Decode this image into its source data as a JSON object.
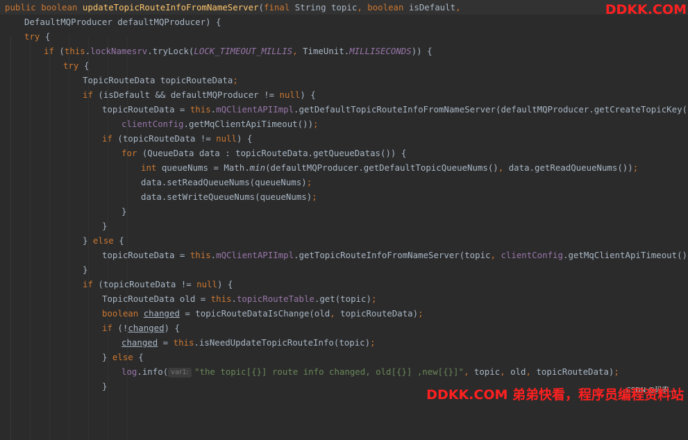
{
  "watermark": {
    "top": "DDKK.COM",
    "bottom": "DDKK.COM 弟弟快看，程序员编程资料站",
    "csdn": "CSDN @码农..."
  },
  "colors": {
    "background": "#2b2b2b",
    "keyword": "#cc7832",
    "method_declaration": "#ffc66d",
    "field": "#9876aa",
    "string": "#6a8759",
    "plain": "#a9b7c6",
    "watermark": "#ff2020"
  },
  "code_lines": [
    {
      "indent": 0,
      "tokens": [
        {
          "t": "kw",
          "v": "public boolean "
        },
        {
          "t": "fn",
          "v": "updateTopicRouteInfoFromNameServer"
        },
        {
          "t": "",
          "v": "("
        },
        {
          "t": "kw",
          "v": "final "
        },
        {
          "t": "",
          "v": "String topic"
        },
        {
          "t": "kw",
          "v": ", boolean "
        },
        {
          "t": "",
          "v": "isDefault"
        },
        {
          "t": "kw",
          "v": ","
        }
      ]
    },
    {
      "indent": 1,
      "tokens": [
        {
          "t": "",
          "v": "DefaultMQProducer defaultMQProducer) {"
        }
      ]
    },
    {
      "indent": 1,
      "tokens": [
        {
          "t": "kw",
          "v": "try "
        },
        {
          "t": "",
          "v": "{"
        }
      ]
    },
    {
      "indent": 2,
      "tokens": [
        {
          "t": "kw",
          "v": "if "
        },
        {
          "t": "",
          "v": "("
        },
        {
          "t": "kw",
          "v": "this"
        },
        {
          "t": "",
          "v": "."
        },
        {
          "t": "fld",
          "v": "lockNamesrv"
        },
        {
          "t": "",
          "v": ".tryLock("
        },
        {
          "t": "it",
          "v": "LOCK_TIMEOUT_MILLIS"
        },
        {
          "t": "kw",
          "v": ", "
        },
        {
          "t": "",
          "v": "TimeUnit."
        },
        {
          "t": "it",
          "v": "MILLISECONDS"
        },
        {
          "t": "",
          "v": ")) {"
        }
      ]
    },
    {
      "indent": 3,
      "tokens": [
        {
          "t": "kw",
          "v": "try "
        },
        {
          "t": "",
          "v": "{"
        }
      ]
    },
    {
      "indent": 4,
      "tokens": [
        {
          "t": "",
          "v": "TopicRouteData topicRouteData"
        },
        {
          "t": "kw",
          "v": ";"
        }
      ]
    },
    {
      "indent": 4,
      "tokens": [
        {
          "t": "kw",
          "v": "if "
        },
        {
          "t": "",
          "v": "(isDefault && defaultMQProducer != "
        },
        {
          "t": "kw",
          "v": "null"
        },
        {
          "t": "",
          "v": ") {"
        }
      ]
    },
    {
      "indent": 5,
      "tokens": [
        {
          "t": "",
          "v": "topicRouteData = "
        },
        {
          "t": "kw",
          "v": "this"
        },
        {
          "t": "",
          "v": "."
        },
        {
          "t": "fld",
          "v": "mQClientAPIImpl"
        },
        {
          "t": "",
          "v": ".getDefaultTopicRouteInfoFromNameServer(defaultMQProducer.getCreateTopicKey()"
        },
        {
          "t": "kw",
          "v": ","
        }
      ]
    },
    {
      "indent": 6,
      "tokens": [
        {
          "t": "fld",
          "v": "clientConfig"
        },
        {
          "t": "",
          "v": ".getMqClientApiTimeout())"
        },
        {
          "t": "kw",
          "v": ";"
        }
      ]
    },
    {
      "indent": 5,
      "tokens": [
        {
          "t": "kw",
          "v": "if "
        },
        {
          "t": "",
          "v": "(topicRouteData != "
        },
        {
          "t": "kw",
          "v": "null"
        },
        {
          "t": "",
          "v": ") {"
        }
      ]
    },
    {
      "indent": 6,
      "tokens": [
        {
          "t": "kw",
          "v": "for "
        },
        {
          "t": "",
          "v": "(QueueData data : topicRouteData.getQueueDatas()) {"
        }
      ]
    },
    {
      "indent": 7,
      "tokens": [
        {
          "t": "kw",
          "v": "int "
        },
        {
          "t": "",
          "v": "queueNums = Math."
        },
        {
          "t": "sm",
          "v": "min"
        },
        {
          "t": "",
          "v": "(defaultMQProducer.getDefaultTopicQueueNums()"
        },
        {
          "t": "kw",
          "v": ", "
        },
        {
          "t": "",
          "v": "data.getReadQueueNums())"
        },
        {
          "t": "kw",
          "v": ";"
        }
      ]
    },
    {
      "indent": 7,
      "tokens": [
        {
          "t": "",
          "v": "data.setReadQueueNums(queueNums)"
        },
        {
          "t": "kw",
          "v": ";"
        }
      ]
    },
    {
      "indent": 7,
      "tokens": [
        {
          "t": "",
          "v": "data.setWriteQueueNums(queueNums)"
        },
        {
          "t": "kw",
          "v": ";"
        }
      ]
    },
    {
      "indent": 6,
      "tokens": [
        {
          "t": "",
          "v": "}"
        }
      ]
    },
    {
      "indent": 5,
      "tokens": [
        {
          "t": "",
          "v": "}"
        }
      ]
    },
    {
      "indent": 4,
      "tokens": [
        {
          "t": "",
          "v": "} "
        },
        {
          "t": "kw",
          "v": "else "
        },
        {
          "t": "",
          "v": "{"
        }
      ]
    },
    {
      "indent": 5,
      "tokens": [
        {
          "t": "",
          "v": "topicRouteData = "
        },
        {
          "t": "kw",
          "v": "this"
        },
        {
          "t": "",
          "v": "."
        },
        {
          "t": "fld",
          "v": "mQClientAPIImpl"
        },
        {
          "t": "",
          "v": ".getTopicRouteInfoFromNameServer(topic"
        },
        {
          "t": "kw",
          "v": ", "
        },
        {
          "t": "fld",
          "v": "clientConfig"
        },
        {
          "t": "",
          "v": ".getMqClientApiTimeout())"
        },
        {
          "t": "kw",
          "v": ";"
        }
      ]
    },
    {
      "indent": 4,
      "tokens": [
        {
          "t": "",
          "v": "}"
        }
      ]
    },
    {
      "indent": 4,
      "tokens": [
        {
          "t": "kw",
          "v": "if "
        },
        {
          "t": "",
          "v": "(topicRouteData != "
        },
        {
          "t": "kw",
          "v": "null"
        },
        {
          "t": "",
          "v": ") {"
        }
      ]
    },
    {
      "indent": 5,
      "tokens": [
        {
          "t": "",
          "v": "TopicRouteData old = "
        },
        {
          "t": "kw",
          "v": "this"
        },
        {
          "t": "",
          "v": "."
        },
        {
          "t": "fld",
          "v": "topicRouteTable"
        },
        {
          "t": "",
          "v": ".get(topic)"
        },
        {
          "t": "kw",
          "v": ";"
        }
      ]
    },
    {
      "indent": 5,
      "tokens": [
        {
          "t": "kw",
          "v": "boolean "
        },
        {
          "t": "und",
          "v": "changed"
        },
        {
          "t": "",
          "v": " = topicRouteDataIsChange(old"
        },
        {
          "t": "kw",
          "v": ", "
        },
        {
          "t": "",
          "v": "topicRouteData)"
        },
        {
          "t": "kw",
          "v": ";"
        }
      ]
    },
    {
      "indent": 5,
      "tokens": [
        {
          "t": "kw",
          "v": "if "
        },
        {
          "t": "",
          "v": "(!"
        },
        {
          "t": "und",
          "v": "changed"
        },
        {
          "t": "",
          "v": ") {"
        }
      ]
    },
    {
      "indent": 6,
      "tokens": [
        {
          "t": "und",
          "v": "changed"
        },
        {
          "t": "",
          "v": " = "
        },
        {
          "t": "kw",
          "v": "this"
        },
        {
          "t": "",
          "v": ".isNeedUpdateTopicRouteInfo(topic)"
        },
        {
          "t": "kw",
          "v": ";"
        }
      ]
    },
    {
      "indent": 5,
      "tokens": [
        {
          "t": "",
          "v": "} "
        },
        {
          "t": "kw",
          "v": "else "
        },
        {
          "t": "",
          "v": "{"
        }
      ]
    },
    {
      "indent": 6,
      "tokens": [
        {
          "t": "fld",
          "v": "log"
        },
        {
          "t": "",
          "v": ".info("
        },
        {
          "t": "hint",
          "v": "var1:"
        },
        {
          "t": "str",
          "v": "\"the topic[{}] route info changed, old[{}] ,new[{}]\""
        },
        {
          "t": "kw",
          "v": ", "
        },
        {
          "t": "",
          "v": "topic"
        },
        {
          "t": "kw",
          "v": ", "
        },
        {
          "t": "",
          "v": "old"
        },
        {
          "t": "kw",
          "v": ", "
        },
        {
          "t": "",
          "v": "topicRouteData)"
        },
        {
          "t": "kw",
          "v": ";"
        }
      ]
    },
    {
      "indent": 5,
      "tokens": [
        {
          "t": "",
          "v": "}"
        }
      ]
    }
  ]
}
